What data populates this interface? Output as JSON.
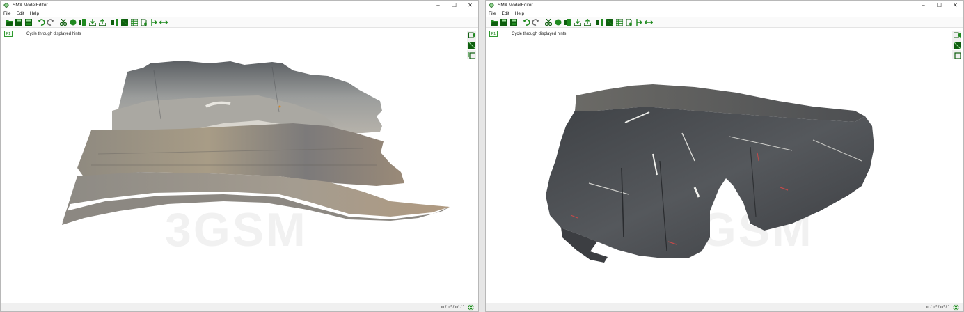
{
  "app": {
    "title": "SMX ModelEditor",
    "menu": [
      "File",
      "Edit",
      "Help"
    ],
    "hint_key": "F1",
    "hint_text": "Cycle through displayed hints",
    "watermark": "3GSM",
    "units": "m / m² / m³ / °"
  },
  "window_controls": {
    "minimize": "–",
    "maximize": "☐",
    "close": "✕"
  },
  "colors": {
    "icon_green": "#1f8a1f",
    "icon_dark_green": "#0e5e0e",
    "icon_gray": "#6a6a6a"
  },
  "toolbar_icons": [
    "open-icon",
    "save-icon",
    "save-as-icon",
    "undo-icon",
    "redo-icon",
    "cut-icon",
    "point-icon",
    "export-icon",
    "import-icon",
    "upload-icon",
    "split-icon",
    "square-icon",
    "table-icon",
    "document-icon",
    "measure-icon",
    "resize-icon"
  ],
  "side_icons": [
    "camera-icon",
    "texture-icon",
    "frame-icon"
  ]
}
